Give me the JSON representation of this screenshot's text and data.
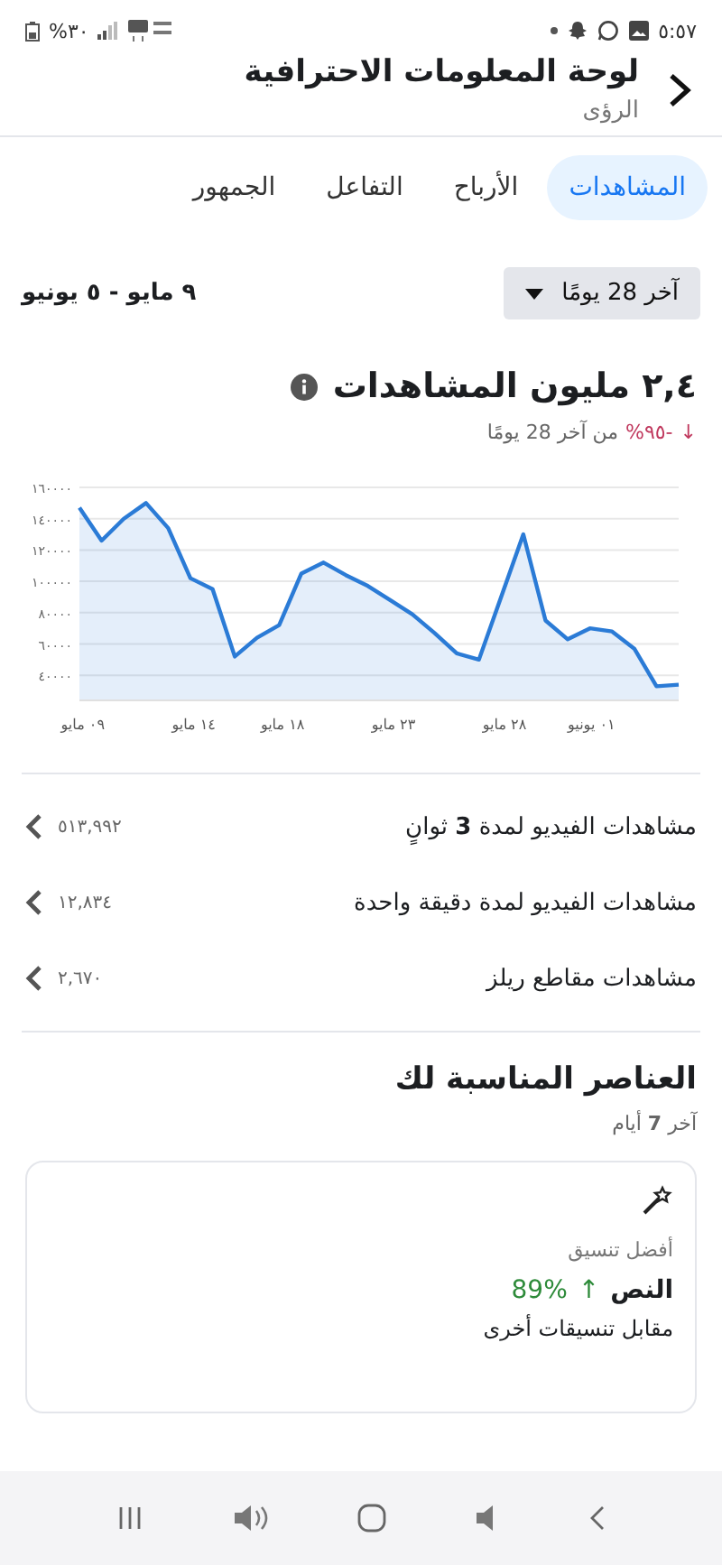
{
  "status_bar": {
    "time": "٥:٥٧",
    "battery": "%٣٠"
  },
  "header": {
    "title": "لوحة المعلومات الاحترافية",
    "subtitle": "الرؤى"
  },
  "tabs": [
    {
      "label": "المشاهدات",
      "selected": true
    },
    {
      "label": "الأرباح",
      "selected": false
    },
    {
      "label": "التفاعل",
      "selected": false
    },
    {
      "label": "الجمهور",
      "selected": false
    }
  ],
  "period": {
    "dropdown": "آخر 28 يومًا",
    "range": "٩ مايو - ٥ يونيو"
  },
  "metric": {
    "value": "٢,٤ مليون المشاهدات",
    "change_arrow": "↓",
    "change": "-٩٥%",
    "change_text": "من آخر 28 يومًا"
  },
  "chart_data": {
    "type": "area",
    "categories": [
      "٠٩ مايو",
      null,
      null,
      null,
      null,
      "١٤ مايو",
      null,
      null,
      null,
      "١٨ مايو",
      null,
      null,
      null,
      null,
      "٢٣ مايو",
      null,
      null,
      null,
      null,
      "٢٨ مايو",
      null,
      null,
      null,
      "٠١ يونيو",
      null,
      null,
      null,
      null
    ],
    "series": [
      {
        "color": "#2b7bd6",
        "values": [
          147000,
          126000,
          140000,
          150000,
          134000,
          102000,
          95000,
          52000,
          64000,
          72000,
          105000,
          112000,
          104000,
          97000,
          88000,
          79000,
          67000,
          54000,
          50000,
          90000,
          130000,
          75000,
          63000,
          70000,
          68000,
          57000,
          33000,
          34000
        ]
      }
    ],
    "grid": true,
    "ylim": [
      24000,
      160000
    ],
    "yticks": [
      {
        "value": 40000,
        "label": "٤٠٠٠٠"
      },
      {
        "value": 60000,
        "label": "٦٠٠٠٠"
      },
      {
        "value": 80000,
        "label": "٨٠٠٠٠"
      },
      {
        "value": 100000,
        "label": "١٠٠٠٠٠"
      },
      {
        "value": 120000,
        "label": "١٢٠٠٠٠"
      },
      {
        "value": 140000,
        "label": "١٤٠٠٠٠"
      },
      {
        "value": 160000,
        "label": "١٦٠٠٠٠"
      }
    ]
  },
  "breakdown": [
    {
      "label": "مشاهدات الفيديو لمدة **3** ثوانٍ",
      "value": "٥١٣,٩٩٢"
    },
    {
      "label": "مشاهدات الفيديو لمدة دقيقة واحدة",
      "value": "١٢,٨٣٤"
    },
    {
      "label": "مشاهدات مقاطع ريلز",
      "value": "٢,٦٧٠"
    }
  ],
  "recommendations": {
    "title": "العناصر المناسبة لك",
    "subtitle": "آخر **7** أيام",
    "card": {
      "label": "أفضل تنسيق",
      "format": "النص",
      "arrow": "↑",
      "percent": "89%",
      "note": "مقابل تنسيقات أخرى"
    }
  }
}
